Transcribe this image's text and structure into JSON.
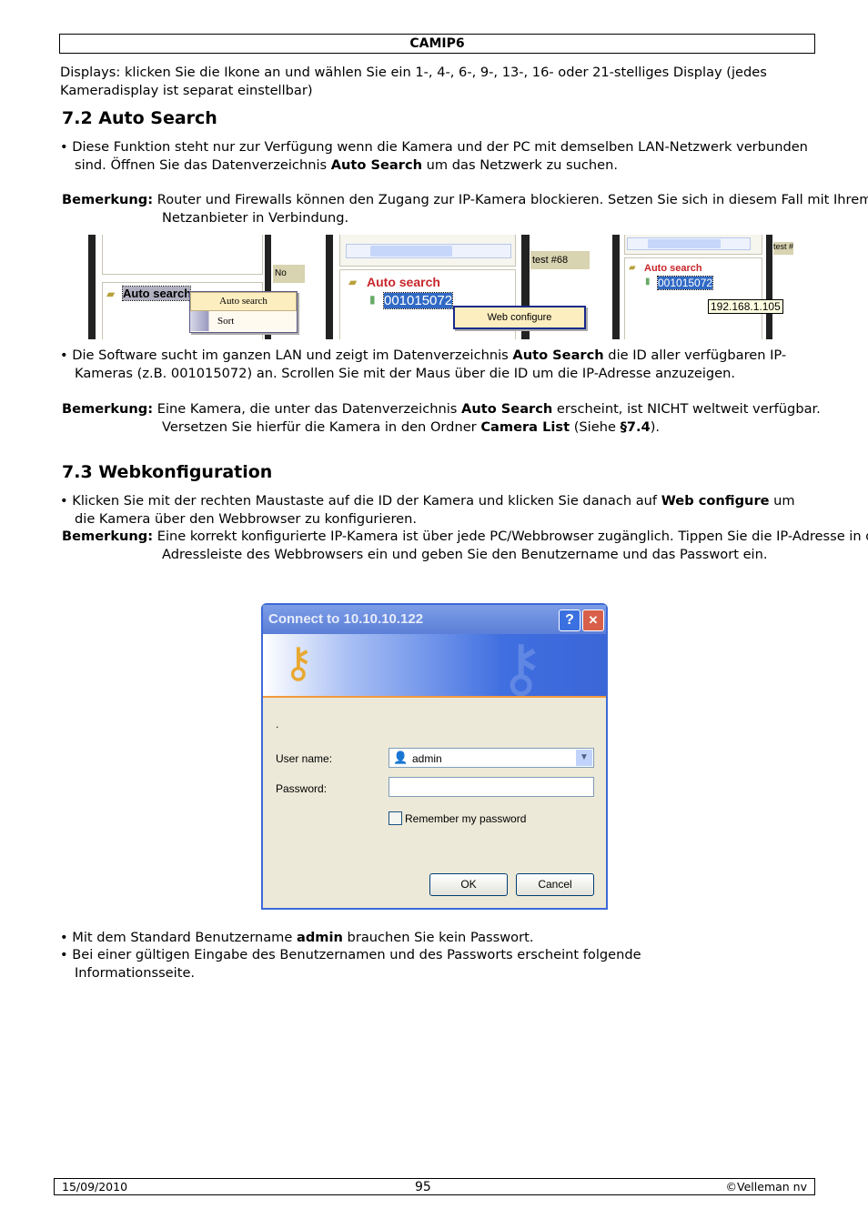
{
  "header": {
    "title": "CAMIP6"
  },
  "intro": "Displays: klicken Sie die Ikone an und wählen Sie ein  1-, 4-, 6-, 9-, 13-, 16- oder 21-stelliges Display (jedes Kameradisplay ist separat einstellbar)",
  "s72": {
    "title": "7.2 Auto Search",
    "bullet1": [
      "Diese Funktion steht nur zur Verfügung wenn die Kamera und der PC mit demselben LAN-Netzwerk verbunden sind. Öffnen Sie das Datenverzeichnis ",
      "Auto Search",
      " um das Netzwerk zu suchen."
    ],
    "note1": [
      "Bemerkung:",
      " Router und Firewalls können den Zugang zur IP-Kamera blockieren. Setzen Sie sich in diesem Fall mit Ihrem Netzanbieter in Verbindung."
    ],
    "bullet2": [
      "Die Software sucht im ganzen LAN und zeigt im Datenverzeichnis ",
      "Auto Search",
      " die ID aller verfügbaren IP-Kameras (z.B. 001015072) an. Scrollen Sie mit der Maus über die ID um die IP-Adresse anzuzeigen."
    ],
    "note2": [
      "Bemerkung:",
      " Eine Kamera, die unter das Datenverzeichnis ",
      "Auto Search",
      " erscheint, ist NICHT weltweit verfügbar. Versetzen Sie hierfür die Kamera in den Ordner ",
      "Camera List",
      " (Siehe ",
      "§7.4",
      ")."
    ]
  },
  "shots": {
    "s1": {
      "col": "No",
      "node": "Auto search",
      "menu": [
        "Auto search",
        "Sort"
      ]
    },
    "s2": {
      "col": "test #68",
      "node": "Auto search",
      "id": "001015072",
      "menu": [
        "Web configure"
      ]
    },
    "s3": {
      "col": "test #",
      "node": "Auto search",
      "id": "001015072",
      "tooltip": "192.168.1.105"
    }
  },
  "s73": {
    "title": "7.3 Webkonfiguration",
    "bullet1": [
      "Klicken Sie mit der rechten Maustaste auf die ID der Kamera und klicken Sie danach auf ",
      "Web configure",
      " um die Kamera über den Webbrowser zu konfigurieren."
    ],
    "note1": [
      "Bemerkung:",
      " Eine korrekt konfigurierte IP-Kamera ist über jede PC/Webbrowser zugänglich. Tippen Sie die IP-Adresse in der Adressleiste des Webbrowsers ein und geben Sie den Benutzername und das Passwort ein."
    ],
    "bullet2": [
      "Mit dem Standard Benutzername ",
      "admin",
      " brauchen Sie kein Passwort."
    ],
    "bullet3": "Bei einer gültigen Eingabe des Benutzernamen und des Passworts erscheint folgende Informationsseite."
  },
  "dialog": {
    "title": "Connect to 10.10.10.122",
    "dot": ".",
    "user_label": "User name:",
    "user_value": "admin",
    "password_label": "Password:",
    "password_value": "",
    "remember_label": "Remember my password",
    "remember_checked": false,
    "ok": "OK",
    "cancel": "Cancel",
    "help": "?",
    "close": "✕"
  },
  "footer": {
    "date": "15/09/2010",
    "page": "95",
    "copyright": "©Velleman nv"
  }
}
